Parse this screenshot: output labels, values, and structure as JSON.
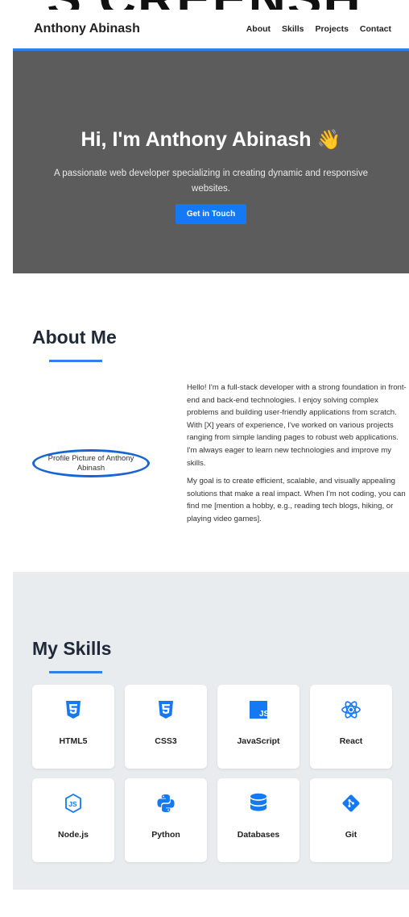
{
  "backdrop": {
    "text": "S CREENSH"
  },
  "navbar": {
    "brand": "Anthony Abinash",
    "links": [
      "About",
      "Skills",
      "Projects",
      "Contact"
    ]
  },
  "hero": {
    "title": "Hi, I'm Anthony Abinash",
    "emoji": "👋",
    "subtitle": "A passionate web developer specializing in creating dynamic and responsive websites.",
    "cta_label": "Get in Touch"
  },
  "about": {
    "title": "About Me",
    "profile_alt": "Profile Picture of Anthony Abinash",
    "paragraphs": [
      "Hello! I'm a full-stack developer with a strong foundation in front-end and back-end technologies. I enjoy solving complex problems and building user-friendly applications from scratch. With [X] years of experience, I've worked on various projects ranging from simple landing pages to robust web applications. I'm always eager to learn new technologies and improve my skills.",
      "My goal is to create efficient, scalable, and visually appealing solutions that make a real impact. When I'm not coding, you can find me [mention a hobby, e.g., reading tech blogs, hiking, or playing video games]."
    ]
  },
  "skills": {
    "title": "My Skills",
    "items": [
      {
        "label": "HTML5",
        "icon": "html5-icon",
        "color": "#1479f2"
      },
      {
        "label": "CSS3",
        "icon": "css3-icon",
        "color": "#1479f2"
      },
      {
        "label": "JavaScript",
        "icon": "js-icon",
        "color": "#1479f2"
      },
      {
        "label": "React",
        "icon": "react-icon",
        "color": "#1479f2"
      },
      {
        "label": "Node.js",
        "icon": "nodejs-icon",
        "color": "#1479f2"
      },
      {
        "label": "Python",
        "icon": "python-icon",
        "color": "#1479f2"
      },
      {
        "label": "Databases",
        "icon": "database-icon",
        "color": "#1479f2"
      },
      {
        "label": "Git",
        "icon": "git-icon",
        "color": "#1479f2"
      }
    ]
  },
  "colors": {
    "accent": "#1479f2",
    "hero_bg": "#5c5c5c",
    "skills_bg": "#e9ecef"
  }
}
